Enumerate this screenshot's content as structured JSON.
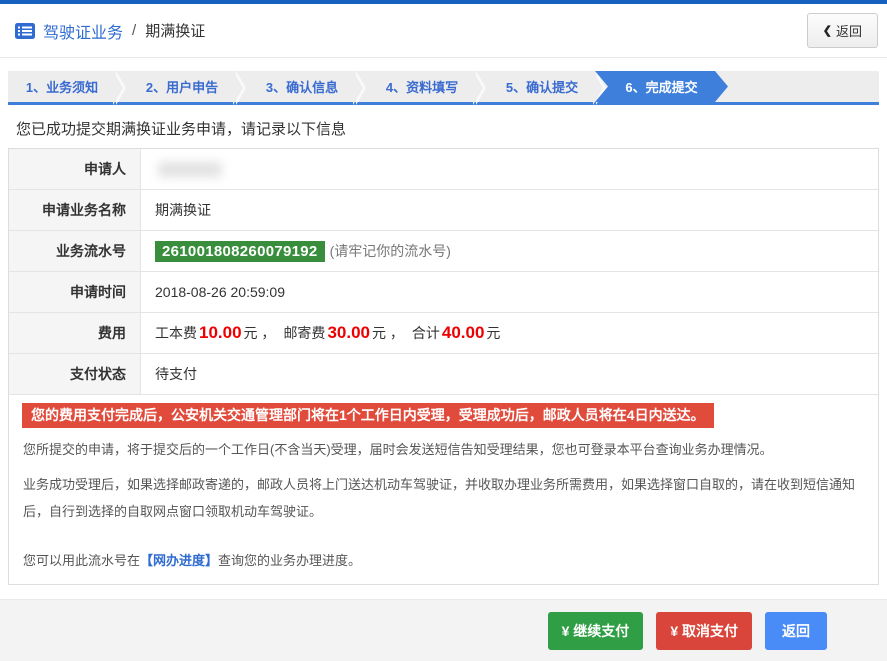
{
  "colors": {
    "top_strip": "#1660c0",
    "accent_blue": "#3d7fdb",
    "step_text_blue": "#3a6bd0",
    "serial_green": "#388e3c",
    "warning_red": "#e14b3c",
    "fee_red": "#ee0000",
    "btn_green": "#2f9e44",
    "btn_red": "#d9453a",
    "btn_blue": "#4a8cf7"
  },
  "header": {
    "breadcrumb_primary": "驾驶证业务",
    "breadcrumb_separator": "/",
    "breadcrumb_secondary": "期满换证",
    "back_chevron": "❮",
    "back_label": "返回"
  },
  "steps": {
    "items": [
      {
        "label": "1、业务须知",
        "active": false
      },
      {
        "label": "2、用户申告",
        "active": false
      },
      {
        "label": "3、确认信息",
        "active": false
      },
      {
        "label": "4、资料填写",
        "active": false
      },
      {
        "label": "5、确认提交",
        "active": false
      },
      {
        "label": "6、完成提交",
        "active": true
      }
    ]
  },
  "main": {
    "success_message": "您已成功提交期满换证业务申请，请记录以下信息",
    "table": {
      "rows": [
        {
          "label": "申请人",
          "value": ""
        },
        {
          "label": "申请业务名称",
          "value": "期满换证"
        },
        {
          "label": "业务流水号",
          "serial": "261001808260079192",
          "note": "(请牢记你的流水号)"
        },
        {
          "label": "申请时间",
          "value": "2018-08-26 20:59:09"
        },
        {
          "label": "费用",
          "fee": {
            "seg1": "工本费",
            "amt1": "10.00",
            "unit1": "元 ，",
            "seg2": "邮寄费",
            "amt2": "30.00",
            "unit2": "元 ，",
            "seg3": "合计",
            "amt3": "40.00",
            "unit3": "元"
          }
        },
        {
          "label": "支付状态",
          "value": "待支付"
        }
      ]
    },
    "warning": "您的费用支付完成后，公安机关交通管理部门将在1个工作日内受理，受理成功后，邮政人员将在4日内送达。",
    "paragraphs": {
      "p1": "您所提交的申请，将于提交后的一个工作日(不含当天)受理，届时会发送短信告知受理结果，您也可登录本平台查询业务办理情况。",
      "p2": "业务成功受理后，如果选择邮政寄递的，邮政人员将上门送达机动车驾驶证，并收取办理业务所需费用，如果选择窗口自取的，请在收到短信通知后，自行到选择的自取网点窗口领取机动车驾驶证。",
      "p3_prefix": "您可以用此流水号在",
      "p3_link": "【网办进度】",
      "p3_suffix": "查询您的业务办理进度。"
    }
  },
  "footer": {
    "continue_label": "¥ 继续支付",
    "cancel_label": "¥ 取消支付",
    "back_label": "返回"
  }
}
